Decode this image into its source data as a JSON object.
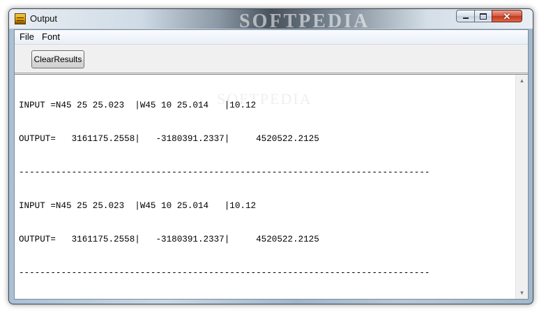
{
  "window": {
    "title": "Output",
    "brand_watermark": "SOFTPEDIA",
    "controls": {
      "minimize": "minimize",
      "maximize": "maximize",
      "close": "✕"
    }
  },
  "menu": {
    "file": "File",
    "font": "Font"
  },
  "toolbar": {
    "clear_results_label": "ClearResults"
  },
  "output": {
    "lines": [
      "INPUT =N45 25 25.023  |W45 10 25.014   |10.12",
      "OUTPUT=   3161175.2558|   -3180391.2337|     4520522.2125",
      "------------------------------------------------------------------------------",
      "INPUT =N45 25 25.023  |W45 10 25.014   |10.12",
      "OUTPUT=   3161175.2558|   -3180391.2337|     4520522.2125",
      "------------------------------------------------------------------------------"
    ],
    "watermark": "SOFTPEDIA"
  },
  "colors": {
    "close_button": "#c2371d",
    "text": "#000000",
    "background": "#ffffff"
  }
}
